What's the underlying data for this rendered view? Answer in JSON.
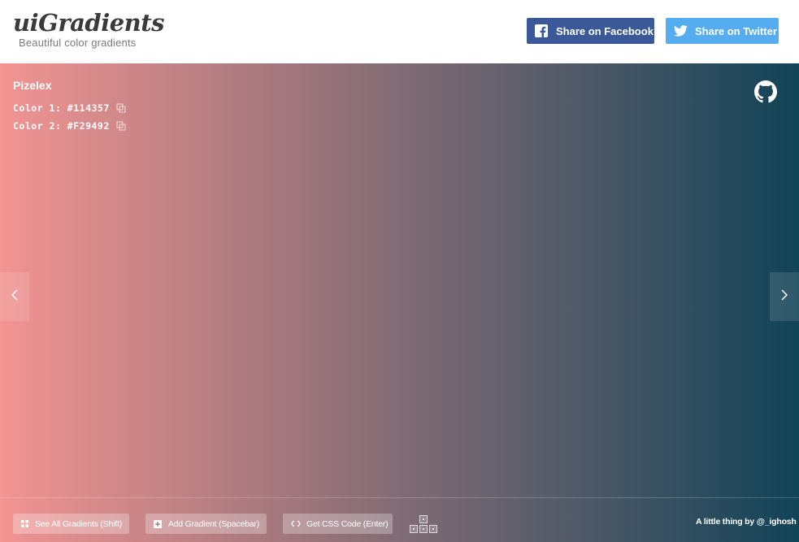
{
  "header": {
    "logo_title": "uiGradients",
    "logo_subtitle": "Beautiful color gradients",
    "share_facebook": "Share on Facebook",
    "share_twitter": "Share on Twitter"
  },
  "gradient": {
    "name": "Pizelex",
    "color1_label": "Color 1: #114357",
    "color2_label": "Color 2: #F29492",
    "color1": "#114357",
    "color2": "#F29492"
  },
  "footer": {
    "see_all": "See All Gradients (Shift)",
    "add_gradient": "Add Gradient (Spacebar)",
    "get_css": "Get CSS Code (Enter)",
    "credit": "A little thing by @_ighosh"
  },
  "colors": {
    "facebook": "#3b5998",
    "twitter": "#55acee"
  },
  "icons": {
    "facebook": "facebook-icon",
    "twitter": "twitter-icon",
    "github": "github-icon",
    "copy": "copy-icon",
    "prev": "chevron-left-icon",
    "next": "chevron-right-icon",
    "grid": "grid-icon",
    "add": "plus-square-icon",
    "code": "code-icon",
    "keys": "arrow-keys-icon"
  }
}
